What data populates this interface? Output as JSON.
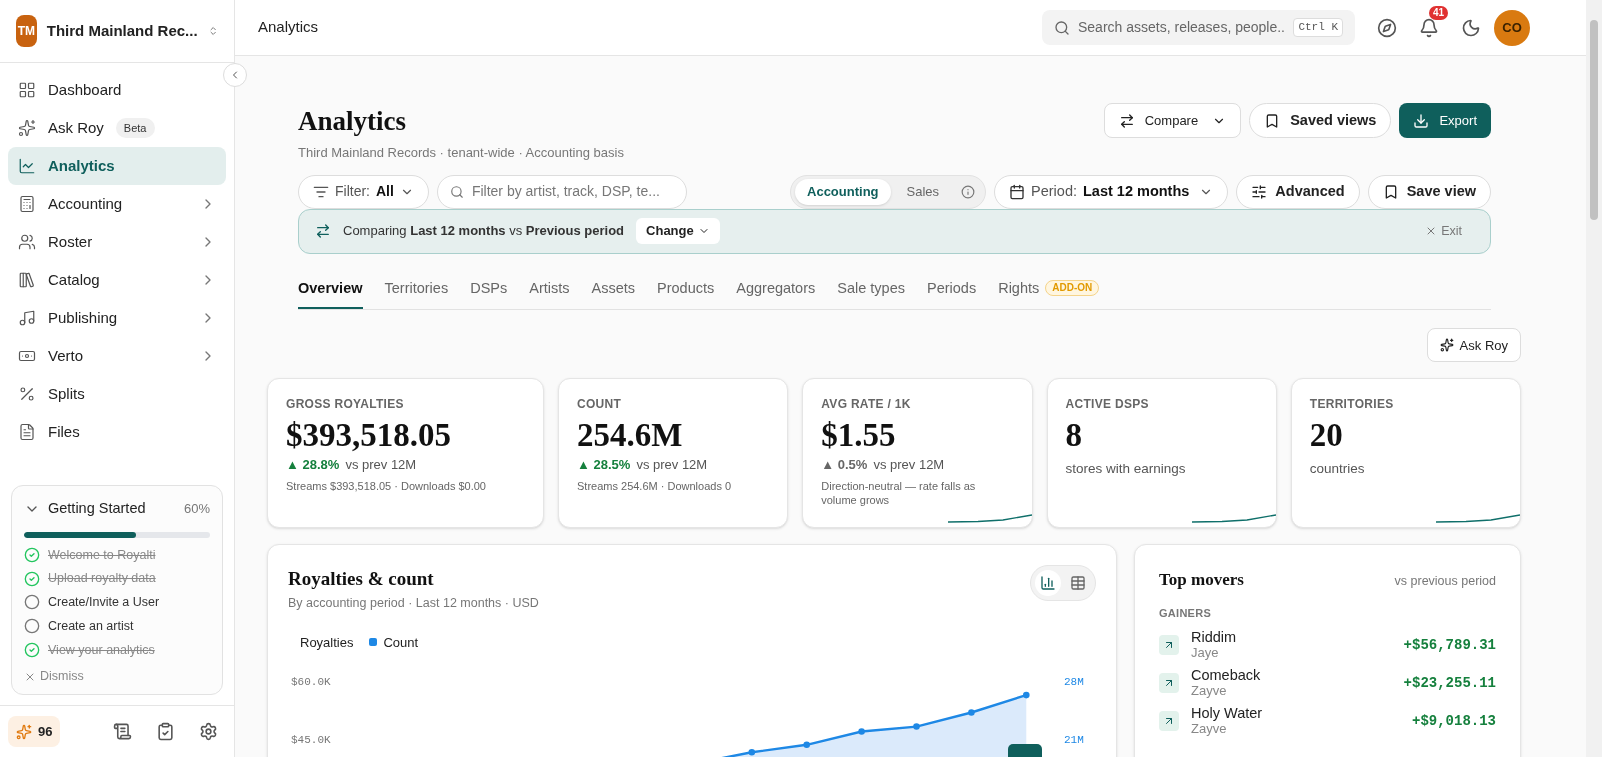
{
  "org": {
    "initials": "TM",
    "name": "Third Mainland Rec..."
  },
  "nav": [
    {
      "label": "Dashboard",
      "selected": false,
      "submenu": false
    },
    {
      "label": "Ask Roy",
      "selected": false,
      "submenu": false,
      "badge": "Beta"
    },
    {
      "label": "Analytics",
      "selected": true,
      "submenu": false
    },
    {
      "label": "Accounting",
      "selected": false,
      "submenu": true
    },
    {
      "label": "Roster",
      "selected": false,
      "submenu": true
    },
    {
      "label": "Catalog",
      "selected": false,
      "submenu": true
    },
    {
      "label": "Publishing",
      "selected": false,
      "submenu": true
    },
    {
      "label": "Verto",
      "selected": false,
      "submenu": true
    },
    {
      "label": "Splits",
      "selected": false,
      "submenu": false
    },
    {
      "label": "Files",
      "selected": false,
      "submenu": false
    }
  ],
  "getting_started": {
    "title": "Getting Started",
    "percent": "60%",
    "level": 0.6,
    "items": [
      {
        "label": "Welcome to Royalti",
        "checked": true
      },
      {
        "label": "Upload royalty data",
        "checked": true
      },
      {
        "label": "Create/Invite a User",
        "checked": false
      },
      {
        "label": "Create an artist",
        "checked": false
      },
      {
        "label": "View your analytics",
        "checked": true
      }
    ],
    "dismiss": "Dismiss"
  },
  "footer": {
    "credits": "96"
  },
  "header": {
    "title": "Analytics",
    "search_placeholder": "Search assets, releases, people..",
    "shortcut": "Ctrl K",
    "notifications": "41",
    "avatar": "CO"
  },
  "page": {
    "title": "Analytics",
    "subtitle": "Third Mainland Records · tenant-wide · Accounting basis",
    "actions": [
      {
        "label": "Compare",
        "kind": "dropdown"
      },
      {
        "label": "Saved views",
        "kind": "outline"
      },
      {
        "label": "Export",
        "kind": "primary"
      }
    ]
  },
  "filters": {
    "filter_label": "Filter:",
    "filter_value": "All",
    "search_placeholder": "Filter by artist, track, DSP, te...",
    "basis": [
      {
        "label": "Accounting",
        "selected": true
      },
      {
        "label": "Sales",
        "selected": false
      }
    ],
    "period_label": "Period:",
    "period_value": "Last 12 months",
    "advanced": "Advanced",
    "save_view": "Save view"
  },
  "compare_banner": {
    "text": "Comparing **Last 12 months** vs **Previous period**",
    "change": "Change",
    "exit": "Exit"
  },
  "tabs": [
    {
      "label": "Overview",
      "selected": true
    },
    {
      "label": "Territories",
      "selected": false
    },
    {
      "label": "DSPs",
      "selected": false
    },
    {
      "label": "Artists",
      "selected": false
    },
    {
      "label": "Assets",
      "selected": false
    },
    {
      "label": "Products",
      "selected": false
    },
    {
      "label": "Aggregators",
      "selected": false
    },
    {
      "label": "Sale types",
      "selected": false
    },
    {
      "label": "Periods",
      "selected": false
    },
    {
      "label": "Rights",
      "selected": false,
      "badge": "ADD-ON"
    }
  ],
  "ask_roy": "Ask Roy",
  "kpis": [
    {
      "label": "GROSS ROYALTIES",
      "value": "$393,518.05",
      "arrow": "▲",
      "change": "28.8%",
      "positive": true,
      "comparison": "vs prev 12M",
      "note": "Streams $393,518.05 · Downloads $0.00",
      "trend_line": false
    },
    {
      "label": "COUNT",
      "value": "254.6M",
      "arrow": "▲",
      "change": "28.5%",
      "positive": true,
      "comparison": "vs prev 12M",
      "note": "Streams 254.6M · Downloads 0",
      "trend_line": false
    },
    {
      "label": "AVG RATE / 1K",
      "value": "$1.55",
      "arrow": "▲",
      "change": "0.5%",
      "positive": false,
      "comparison": "vs prev 12M",
      "note": "Direction-neutral — rate falls as volume grows",
      "trend_line": true
    },
    {
      "label": "ACTIVE DSPS",
      "value": "8",
      "caption": "stores with earnings",
      "trend_line": true
    },
    {
      "label": "TERRITORIES",
      "value": "20",
      "caption": "countries",
      "trend_line": true
    }
  ],
  "royalties_chart": {
    "title": "Royalties & count",
    "subtitle": "By accounting period · Last 12 months · USD",
    "views": [
      {
        "kind": "chart",
        "selected": true
      },
      {
        "kind": "table",
        "selected": false
      }
    ],
    "hidden_legend": "Royalties",
    "royalties_axis": [
      "$60.0K",
      "$45.0K"
    ],
    "series": [
      {
        "name": "Count",
        "color": "#1e88e5"
      }
    ],
    "count_axis": [
      "28M",
      "21M"
    ]
  },
  "top_movers": {
    "title": "Top movers",
    "subtitle": "vs previous period",
    "section": "GAINERS",
    "rows": [
      {
        "title": "Riddim",
        "artist": "Jaye",
        "amount": "+$56,789.31"
      },
      {
        "title": "Comeback",
        "artist": "Zayve",
        "amount": "+$23,255.11"
      },
      {
        "title": "Holy Water",
        "artist": "Zayve",
        "amount": "+$9,018.13"
      }
    ]
  }
}
